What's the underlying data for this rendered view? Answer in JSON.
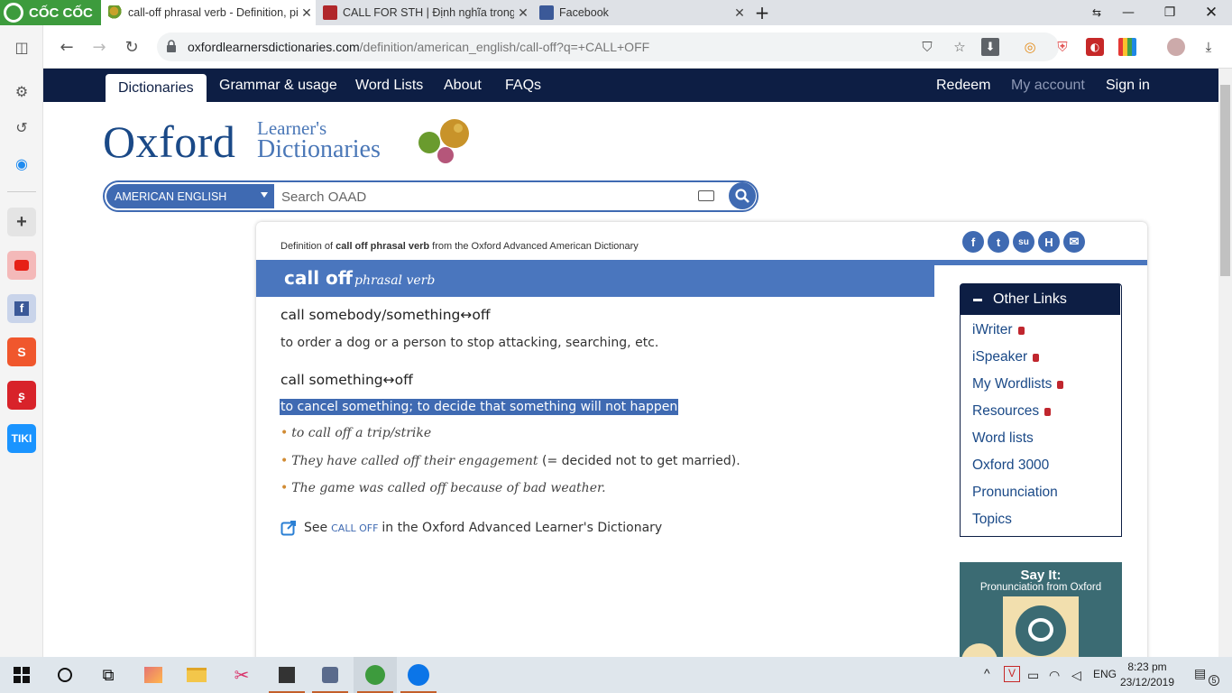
{
  "browser": {
    "brand": "CỐC CỐC",
    "tabs": [
      {
        "title": "call-off phrasal verb - Definition, pictures, pronunciation and usage notes",
        "active": true
      },
      {
        "title": "CALL FOR STH | Định nghĩa trong Từ điển tiếng Anh Cambridge",
        "active": false
      },
      {
        "title": "Facebook",
        "active": false
      }
    ],
    "new_tab_label": "+",
    "url_host": "oxfordlearnersdictionaries.com",
    "url_path": "/definition/american_english/call-off?q=+CALL+OFF"
  },
  "site": {
    "nav_left": [
      "Dictionaries",
      "Grammar & usage",
      "Word Lists",
      "About",
      "FAQs"
    ],
    "nav_right": [
      "Redeem",
      "My account",
      "Sign in"
    ],
    "logo_main": "Oxford",
    "logo_sub1": "Learner's",
    "logo_sub2": "Dictionaries",
    "search": {
      "dictionary": "AMERICAN ENGLISH",
      "placeholder": "Search OAAD"
    }
  },
  "entry": {
    "definition_of_prefix": "Definition of ",
    "definition_of_bold": "call off phrasal verb",
    "definition_of_suffix": " from the Oxford Advanced American Dictionary",
    "headword": "call off",
    "pos": "phrasal verb",
    "senses": [
      {
        "head": "call somebody/something↔off",
        "def": "to order a dog or a person to stop attacking, searching, etc."
      },
      {
        "head": "call something↔off",
        "def": "to cancel something; to decide that something will not happen",
        "examples": [
          {
            "text": "to call off a trip/strike",
            "gloss": ""
          },
          {
            "text": "They have called off their engagement",
            "gloss": " (= decided not to get married)."
          },
          {
            "text": "The game was called off because of bad weather.",
            "gloss": ""
          }
        ]
      }
    ],
    "see_prefix": "See",
    "see_link": "CALL OFF",
    "see_suffix": "in the Oxford Advanced Learner's Dictionary"
  },
  "other_links": {
    "title": "Other Links",
    "items": [
      {
        "label": "iWriter",
        "locked": true
      },
      {
        "label": "iSpeaker",
        "locked": true
      },
      {
        "label": "My Wordlists",
        "locked": true
      },
      {
        "label": "Resources",
        "locked": true
      },
      {
        "label": "Word lists",
        "locked": false
      },
      {
        "label": "Oxford 3000",
        "locked": false
      },
      {
        "label": "Pronunciation",
        "locked": false
      },
      {
        "label": "Topics",
        "locked": false
      }
    ]
  },
  "promo": {
    "title": "Say It:",
    "subtitle": "Pronunciation from Oxford"
  },
  "sidebar_apps": [
    "settings-icon",
    "history-icon",
    "messenger-icon",
    "add-icon",
    "youtube-icon",
    "facebook-icon",
    "shopee-icon",
    "sendo-icon",
    "tiki-icon"
  ],
  "tiki_label": "TIKI",
  "taskbar": {
    "lang": "ENG",
    "time": "8:23 pm",
    "date": "23/12/2019",
    "notifications": "5"
  },
  "colors": {
    "oxford_navy": "#0d1e44",
    "oxford_blue": "#4a76be",
    "link_blue": "#1a4987",
    "coccoc_green": "#3d9b3d"
  }
}
